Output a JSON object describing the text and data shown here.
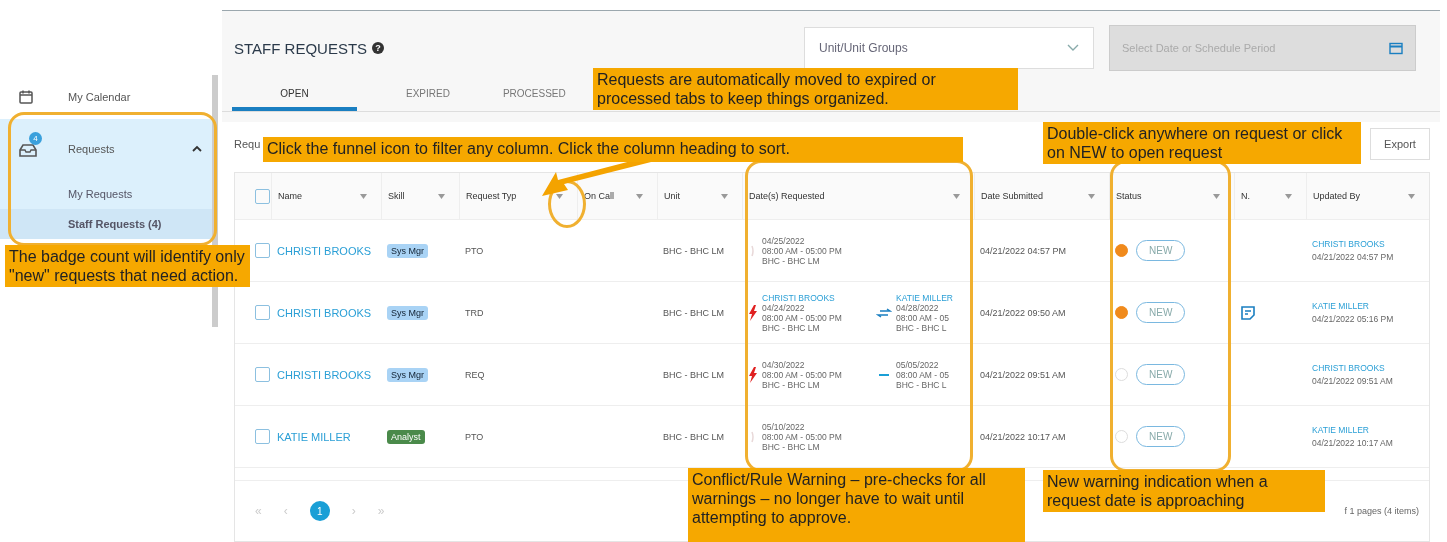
{
  "sidebar": {
    "items": [
      {
        "label": "My Calendar",
        "selected": false
      },
      {
        "label": "Requests",
        "badge": "4",
        "expanded": true,
        "selected": true,
        "children": [
          {
            "label": "My Requests",
            "selected": false
          },
          {
            "label": "Staff Requests (4)",
            "selected": true
          }
        ]
      }
    ]
  },
  "header": {
    "title": "STAFF REQUESTS",
    "help": "?",
    "unit_select": {
      "placeholder": "Unit/Unit Groups"
    },
    "date_field": {
      "placeholder": "Select Date or Schedule Period",
      "disabled": true
    }
  },
  "tabs": [
    {
      "label": "OPEN",
      "selected": true
    },
    {
      "label": "EXPIRED",
      "selected": false
    },
    {
      "label": "PROCESSED",
      "selected": false
    }
  ],
  "toolbar": {
    "label": "Requ",
    "export": "Export"
  },
  "table": {
    "all_checked": false,
    "columns": [
      "Name",
      "Skill",
      "Request Typ",
      "On Call",
      "Unit",
      "Date(s) Requested",
      "Date Submitted",
      "Status",
      "N.",
      "Updated By"
    ],
    "rows": [
      {
        "checked": false,
        "name": "CHRISTI BROOKS",
        "skill": {
          "label": "Sys Mgr",
          "color": "#a9d3f5"
        },
        "type": "PTO",
        "unit": "BHC - BHC LM",
        "conflict": false,
        "dates": {
          "left": {
            "date": "04/25/2022",
            "time": "08:00 AM - 05:00 PM",
            "unit": "BHC - BHC LM"
          }
        },
        "submitted": "04/21/2022 04:57 PM",
        "warning": true,
        "status": "NEW",
        "note": false,
        "updated_by": "CHRISTI BROOKS",
        "updated_at": "04/21/2022 04:57 PM"
      },
      {
        "checked": false,
        "name": "CHRISTI BROOKS",
        "skill": {
          "label": "Sys Mgr",
          "color": "#a9d3f5"
        },
        "type": "TRD",
        "unit": "BHC - BHC LM",
        "conflict": true,
        "dates": {
          "left": {
            "name": "CHRISTI BROOKS",
            "date": "04/24/2022",
            "time": "08:00 AM - 05:00 PM",
            "unit": "BHC - BHC LM"
          },
          "kind": "trade",
          "right": {
            "name": "KATIE MILLER",
            "date": "04/28/2022",
            "time": "08:00 AM - 05",
            "unit": "BHC - BHC L"
          }
        },
        "submitted": "04/21/2022 09:50 AM",
        "warning": true,
        "status": "NEW",
        "note": true,
        "updated_by": "KATIE MILLER",
        "updated_at": "04/21/2022 05:16 PM"
      },
      {
        "checked": false,
        "name": "CHRISTI BROOKS",
        "skill": {
          "label": "Sys Mgr",
          "color": "#a9d3f5"
        },
        "type": "REQ",
        "unit": "BHC - BHC LM",
        "conflict": true,
        "dates": {
          "left": {
            "date": "04/30/2022",
            "time": "08:00 AM - 05:00 PM",
            "unit": "BHC - BHC LM"
          },
          "kind": "range",
          "right": {
            "date": "05/05/2022",
            "time": "08:00 AM - 05",
            "unit": "BHC - BHC L"
          }
        },
        "submitted": "04/21/2022 09:51 AM",
        "warning": false,
        "status": "NEW",
        "note": false,
        "updated_by": "CHRISTI BROOKS",
        "updated_at": "04/21/2022 09:51 AM"
      },
      {
        "checked": false,
        "name": "KATIE MILLER",
        "skill": {
          "label": "Analyst",
          "color": "#4a8a4a"
        },
        "type": "PTO",
        "unit": "BHC - BHC LM",
        "conflict": false,
        "dates": {
          "left": {
            "date": "05/10/2022",
            "time": "08:00 AM - 05:00 PM",
            "unit": "BHC - BHC LM"
          }
        },
        "submitted": "04/21/2022 10:17 AM",
        "warning": false,
        "status": "NEW",
        "note": false,
        "updated_by": "KATIE MILLER",
        "updated_at": "04/21/2022 10:17 AM"
      }
    ]
  },
  "pagination": {
    "first": "«",
    "prev": "‹",
    "pages": [
      {
        "label": "1",
        "selected": true
      }
    ],
    "next": "›",
    "last": "»",
    "summary": "f 1 pages (4 items)"
  },
  "callouts": [
    {
      "kind": "tabs",
      "text": "Requests are automatically moved to expired or processed tabs to keep things organized."
    },
    {
      "kind": "funnel",
      "text": "Click the funnel icon to filter any column.  Click the column heading to sort."
    },
    {
      "kind": "open",
      "text": "Double-click anywhere on request or click on NEW to open request"
    },
    {
      "kind": "badge",
      "text": "The badge count will identify only \"new\" requests that need action."
    },
    {
      "kind": "conflict",
      "text": "Conflict/Rule Warning – pre-checks for all warnings – no longer have to wait until attempting to approve."
    },
    {
      "kind": "approach",
      "text": "New warning indication when a request date is approaching"
    }
  ]
}
